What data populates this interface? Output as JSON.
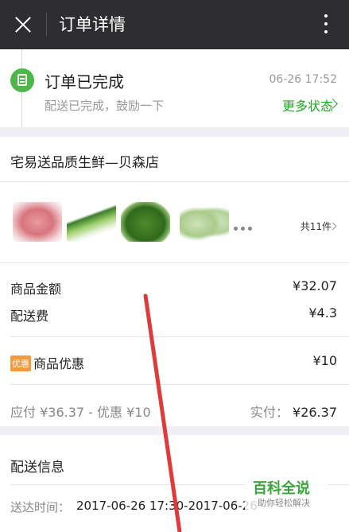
{
  "header": {
    "title": "订单详情",
    "close_icon": "close-icon",
    "more_icon": "more-vertical-icon"
  },
  "status": {
    "title": "订单已完成",
    "time": "06-26 17:52",
    "subtitle": "配送已完成，鼓励一下",
    "more_label": "更多状态",
    "accent_color": "#1aad19",
    "icon": "order-doc-icon"
  },
  "shop": {
    "name": "宅易送品质生鲜—贝森店",
    "items": [
      "meat",
      "green-onion",
      "green-beans",
      "bitter-melon"
    ],
    "count_label": "共11件"
  },
  "pricing": {
    "goods_label": "商品金额",
    "goods_value": "¥32.07",
    "delivery_label": "配送费",
    "delivery_value": "¥4.3",
    "promo_badge": "优惠",
    "promo_label": "商品优惠",
    "promo_value": "¥10",
    "payable_text": "应付 ¥36.37 - 优惠 ¥10",
    "paid_label": "实付：",
    "paid_value": "¥26.37"
  },
  "delivery": {
    "title": "配送信息",
    "time_label": "送达时间：",
    "time_value": "2017-06-26 17:30-2017-06-26"
  },
  "watermark": {
    "title": "百科全说",
    "subtitle": "助你轻松解决"
  }
}
